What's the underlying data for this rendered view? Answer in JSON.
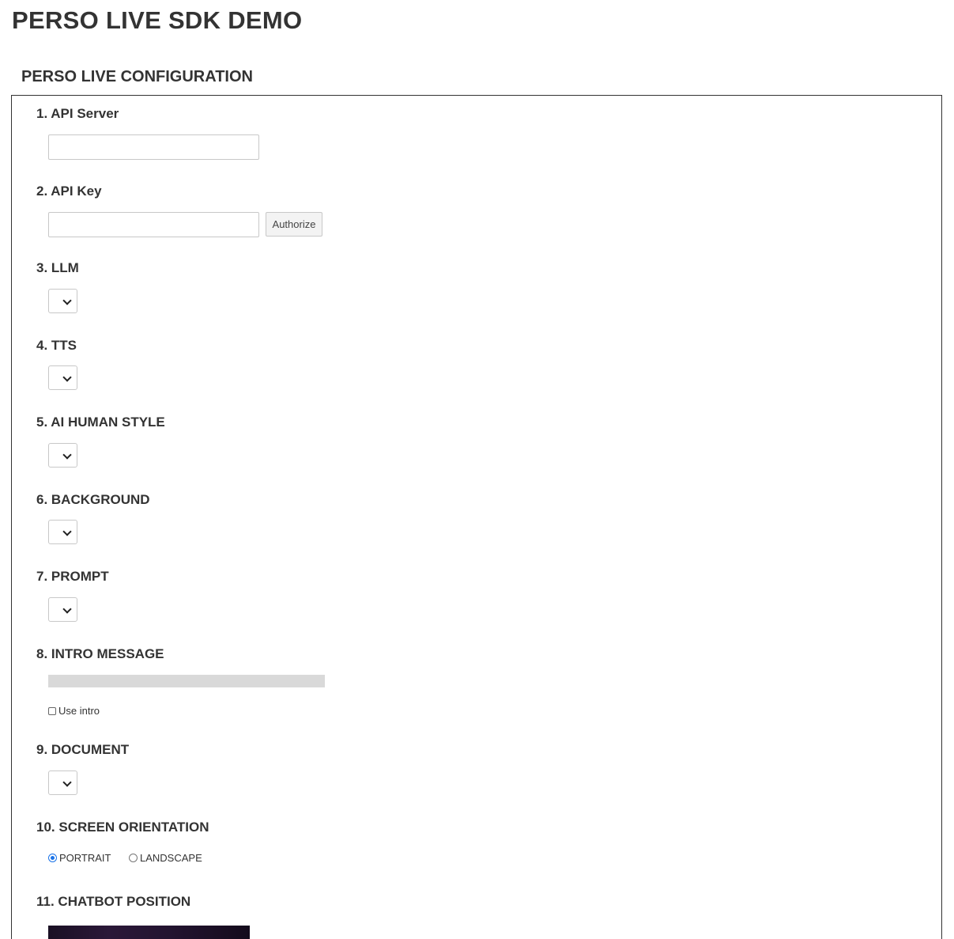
{
  "header": {
    "title": "PERSO LIVE SDK DEMO"
  },
  "config": {
    "heading": "PERSO LIVE CONFIGURATION",
    "api_server": {
      "label": "1. API Server",
      "value": "",
      "placeholder": ""
    },
    "api_key": {
      "label": "2. API Key",
      "value": "",
      "placeholder": "",
      "authorize_label": "Authorize"
    },
    "llm": {
      "label": "3. LLM",
      "selected": ""
    },
    "tts": {
      "label": "4. TTS",
      "selected": ""
    },
    "ai_human_style": {
      "label": "5. AI HUMAN STYLE",
      "selected": ""
    },
    "background": {
      "label": "6. BACKGROUND",
      "selected": ""
    },
    "prompt": {
      "label": "7. PROMPT",
      "selected": ""
    },
    "intro_message": {
      "label": "8. INTRO MESSAGE",
      "value": "",
      "use_intro_label": "Use intro",
      "use_intro_checked": false
    },
    "document": {
      "label": "9. DOCUMENT",
      "selected": ""
    },
    "screen_orientation": {
      "label": "10. SCREEN ORIENTATION",
      "options": [
        {
          "label": "PORTRAIT",
          "checked": true
        },
        {
          "label": "LANDSCAPE",
          "checked": false
        }
      ]
    },
    "chatbot_position": {
      "label": "11. CHATBOT POSITION"
    }
  },
  "colors": {
    "accent": "#1a73e8",
    "border": "#333333",
    "text": "#333333"
  }
}
